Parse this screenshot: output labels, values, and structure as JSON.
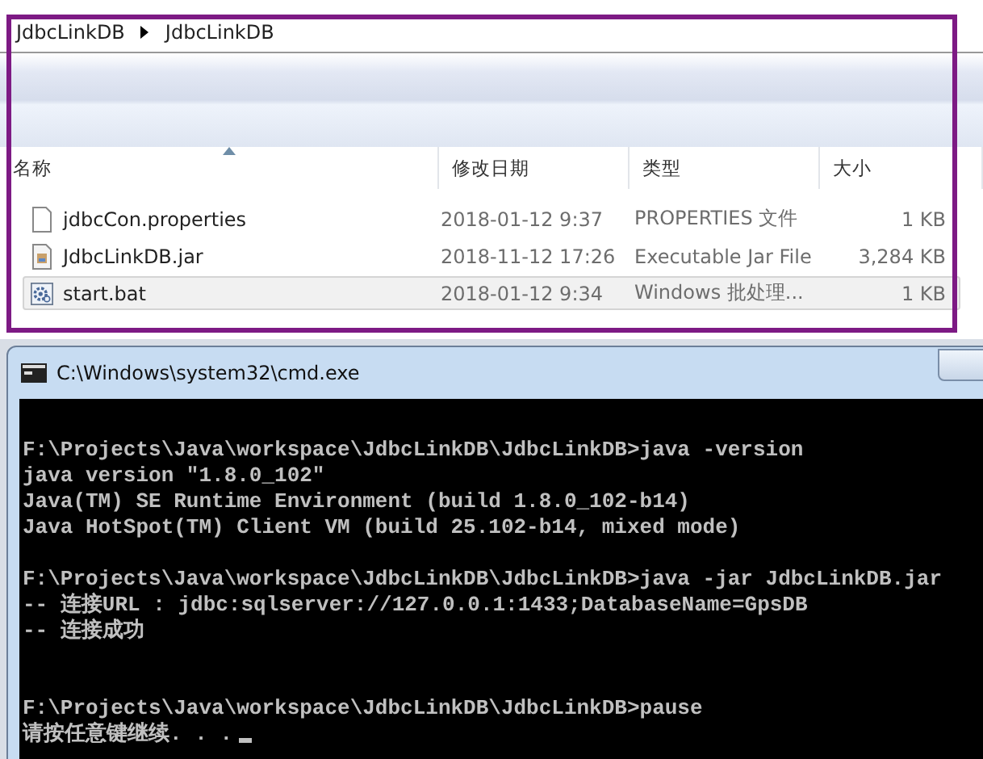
{
  "explorer": {
    "breadcrumb": [
      "JdbcLinkDB",
      "JdbcLinkDB"
    ],
    "columns": [
      "名称",
      "修改日期",
      "类型",
      "大小"
    ],
    "files": [
      {
        "kind": "text",
        "name": "jdbcCon.properties",
        "modified": "2018-01-12 9:37",
        "type": "PROPERTIES 文件",
        "size": "1 KB",
        "selected": false
      },
      {
        "kind": "jar",
        "name": "JdbcLinkDB.jar",
        "modified": "2018-11-12 17:26",
        "type": "Executable Jar File",
        "size": "3,284 KB",
        "selected": false
      },
      {
        "kind": "batch",
        "name": "start.bat",
        "modified": "2018-01-12 9:34",
        "type": "Windows 批处理...",
        "size": "1 KB",
        "selected": true
      }
    ]
  },
  "console": {
    "title": "C:\\Windows\\system32\\cmd.exe",
    "blocks": [
      [
        "F:\\Projects\\Java\\workspace\\JdbcLinkDB\\JdbcLinkDB>java -version",
        "java version \"1.8.0_102\"",
        "Java(TM) SE Runtime Environment (build 1.8.0_102-b14)",
        "Java HotSpot(TM) Client VM (build 25.102-b14, mixed mode)"
      ],
      [
        "F:\\Projects\\Java\\workspace\\JdbcLinkDB\\JdbcLinkDB>java -jar JdbcLinkDB.jar",
        "-- 连接URL : jdbc:sqlserver://127.0.0.1:1433;DatabaseName=GpsDB",
        "-- 连接成功"
      ],
      [
        "F:\\Projects\\Java\\workspace\\JdbcLinkDB\\JdbcLinkDB>pause",
        "请按任意键继续. . ."
      ]
    ]
  }
}
